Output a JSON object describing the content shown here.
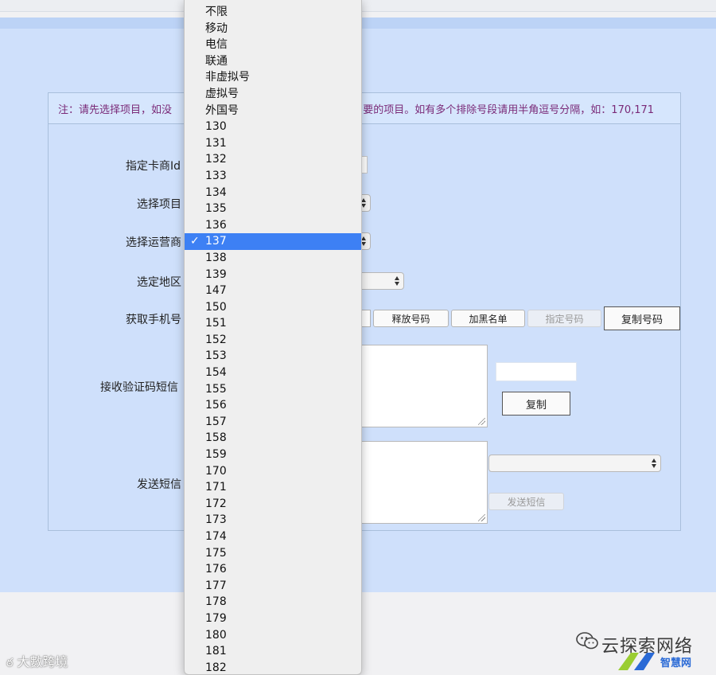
{
  "notice": {
    "text_left": "注：请先选择项目，如没",
    "text_right": "要的项目。如有多个排除号段请用半角逗号分隔，如：170,171"
  },
  "form": {
    "labels": {
      "card_vendor_id": "指定卡商Id",
      "project": "选择项目",
      "operator": "选择运营商",
      "region": "选定地区",
      "get_phone": "获取手机号",
      "receive_sms": "接收验证码短信",
      "send_sms": "发送短信"
    },
    "buttons": {
      "release": "释放号码",
      "blacklist": "加黑名单",
      "assign": "指定号码",
      "copy_number": "复制号码",
      "copy": "复制",
      "send": "发送短信"
    }
  },
  "operator_dropdown": {
    "selected": "137",
    "options": [
      "不限",
      "移动",
      "电信",
      "联通",
      "非虚拟号",
      "虚拟号",
      "外国号",
      "130",
      "131",
      "132",
      "133",
      "134",
      "135",
      "136",
      "137",
      "138",
      "139",
      "147",
      "150",
      "151",
      "152",
      "153",
      "154",
      "155",
      "156",
      "157",
      "158",
      "159",
      "170",
      "171",
      "172",
      "173",
      "174",
      "175",
      "176",
      "177",
      "178",
      "179",
      "180",
      "181",
      "182"
    ]
  },
  "watermarks": {
    "left": "大數跨境",
    "right": "云探索网络",
    "logo": "智慧网"
  },
  "colors": {
    "panel_bg": "#cfe0fb",
    "notice_text": "#7a2a78",
    "selection": "#3d80f4"
  }
}
